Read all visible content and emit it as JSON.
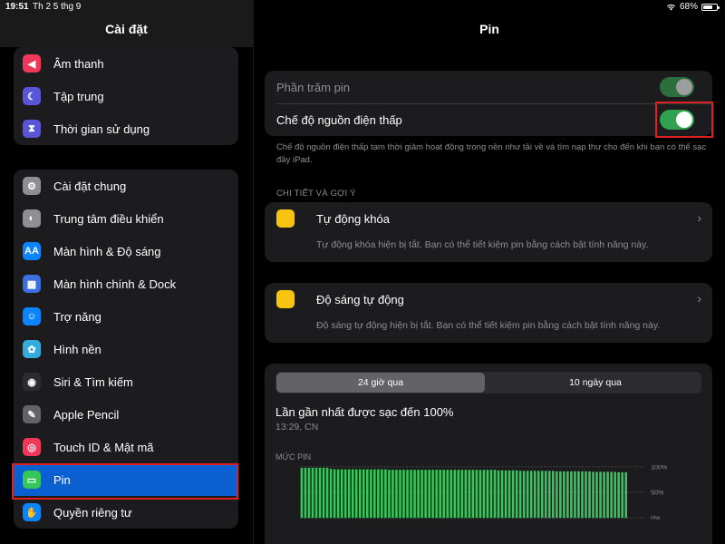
{
  "status_bar": {
    "time": "19:51",
    "date": "Th 2 5 thg 9",
    "battery": "68%",
    "battery_level": 0.68
  },
  "sidebar": {
    "title": "Cài đặt",
    "group1": [
      {
        "label": "Âm thanh",
        "icon": "speaker-icon",
        "color": "#f2385a"
      },
      {
        "label": "Tập trung",
        "icon": "moon-icon",
        "color": "#5856d6"
      },
      {
        "label": "Thời gian sử dụng",
        "icon": "hourglass-icon",
        "color": "#5856d6"
      }
    ],
    "group2": [
      {
        "label": "Cài đặt chung",
        "icon": "gear-icon",
        "color": "#8e8e93"
      },
      {
        "label": "Trung tâm điều khiển",
        "icon": "switches-icon",
        "color": "#8e8e93"
      },
      {
        "label": "Màn hình & Độ sáng",
        "icon": "aa-icon",
        "color": "#0a84ff",
        "glyph": "AA"
      },
      {
        "label": "Màn hình chính & Dock",
        "icon": "grid-icon",
        "color": "#3d6fe0"
      },
      {
        "label": "Trợ năng",
        "icon": "accessibility-icon",
        "color": "#0a84ff"
      },
      {
        "label": "Hình nền",
        "icon": "flower-icon",
        "color": "#35aadc"
      },
      {
        "label": "Siri & Tìm kiếm",
        "icon": "siri-icon",
        "color": "#2c2c2e"
      },
      {
        "label": "Apple Pencil",
        "icon": "pencil-icon",
        "color": "#636366"
      },
      {
        "label": "Touch ID & Mật mã",
        "icon": "fingerprint-icon",
        "color": "#f2385a"
      },
      {
        "label": "Pin",
        "icon": "battery-icon",
        "color": "#34c759",
        "selected": true
      },
      {
        "label": "Quyền riêng tư",
        "icon": "hand-icon",
        "color": "#0a84ff"
      }
    ]
  },
  "main": {
    "title": "Pin",
    "toggles": [
      {
        "label": "Phần trăm pin",
        "on": true,
        "dim": true
      },
      {
        "label": "Chế độ nguồn điện thấp",
        "on": true
      }
    ],
    "low_power_note": "Chế độ nguồn điện thấp tạm thời giảm hoạt động trong nền như tải về và tìm nạp thư cho đến khi bạn có thể sạc đầy iPad.",
    "suggestions_header": "CHI TIẾT VÀ GỢI Ý",
    "suggestions": [
      {
        "title": "Tự động khóa",
        "desc": "Tự động khóa hiện bị tắt. Bạn có thể tiết kiệm pin bằng cách bật tính năng này.",
        "icon": "bulb-icon"
      },
      {
        "title": "Độ sáng tự động",
        "desc": "Độ sáng tự động hiện bị tắt. Bạn có thể tiết kiệm pin bằng cách bật tính năng này.",
        "icon": "bulb-icon"
      }
    ],
    "usage": {
      "tabs": [
        "24 giờ qua",
        "10 ngày qua"
      ],
      "active_tab": 0,
      "last_charged": "Lần gần nhất được sạc đến 100%",
      "charged_time": "13:29, CN",
      "chart_label": "MỨC PIN",
      "y_ticks": [
        "100%",
        "50%",
        "0%"
      ]
    }
  },
  "chart_data": {
    "type": "bar",
    "title": "MỨC PIN",
    "ylim": [
      0,
      100
    ],
    "y_ticks": [
      "100%",
      "50%",
      "0%"
    ],
    "color": "#34c759",
    "values": [
      98,
      98,
      98,
      98,
      98,
      98,
      98,
      98,
      96,
      95,
      95,
      95,
      95,
      95,
      95,
      95,
      95,
      95,
      95,
      95,
      95,
      95,
      95,
      95,
      94,
      94,
      94,
      94,
      94,
      94,
      94,
      94,
      94,
      94,
      94,
      94,
      94,
      94,
      94,
      94,
      94,
      94,
      94,
      94,
      94,
      94,
      94,
      94,
      94,
      94,
      94,
      94,
      94,
      94,
      93,
      93,
      93,
      93,
      93,
      93,
      92,
      92,
      92,
      92,
      92,
      92,
      92,
      92,
      92,
      92,
      91,
      91,
      91,
      91,
      91,
      91,
      91,
      91,
      91,
      91,
      90,
      90,
      90,
      90,
      90,
      90,
      90,
      89,
      89,
      89
    ]
  }
}
